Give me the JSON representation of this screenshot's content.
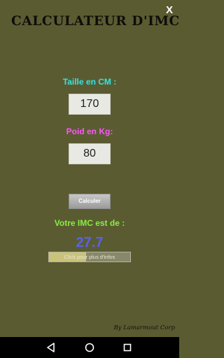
{
  "app": {
    "title": "CALCULATEUR D'IMC",
    "close_label": "X"
  },
  "form": {
    "taille_label": "Taille en CM :",
    "taille_value": "170",
    "poids_label": "Poid en Kg:",
    "poids_value": "80",
    "calc_button_label": "Calculer"
  },
  "result": {
    "label": "Votre IMC est de :",
    "value": "27.7",
    "info_label": "Click pour plus d'infos",
    "info_progress": 0.46
  },
  "footer": {
    "credit": "By Lamarmout Corp"
  },
  "icons": {
    "back": "back-triangle-icon",
    "home": "home-circle-icon",
    "recent": "recent-square-icon"
  },
  "colors": {
    "background": "#5b5b32",
    "taille_label": "#33e5e5",
    "poids_label": "#ff55ff",
    "result_label": "#88ee44",
    "imc_value": "#5563ee"
  }
}
